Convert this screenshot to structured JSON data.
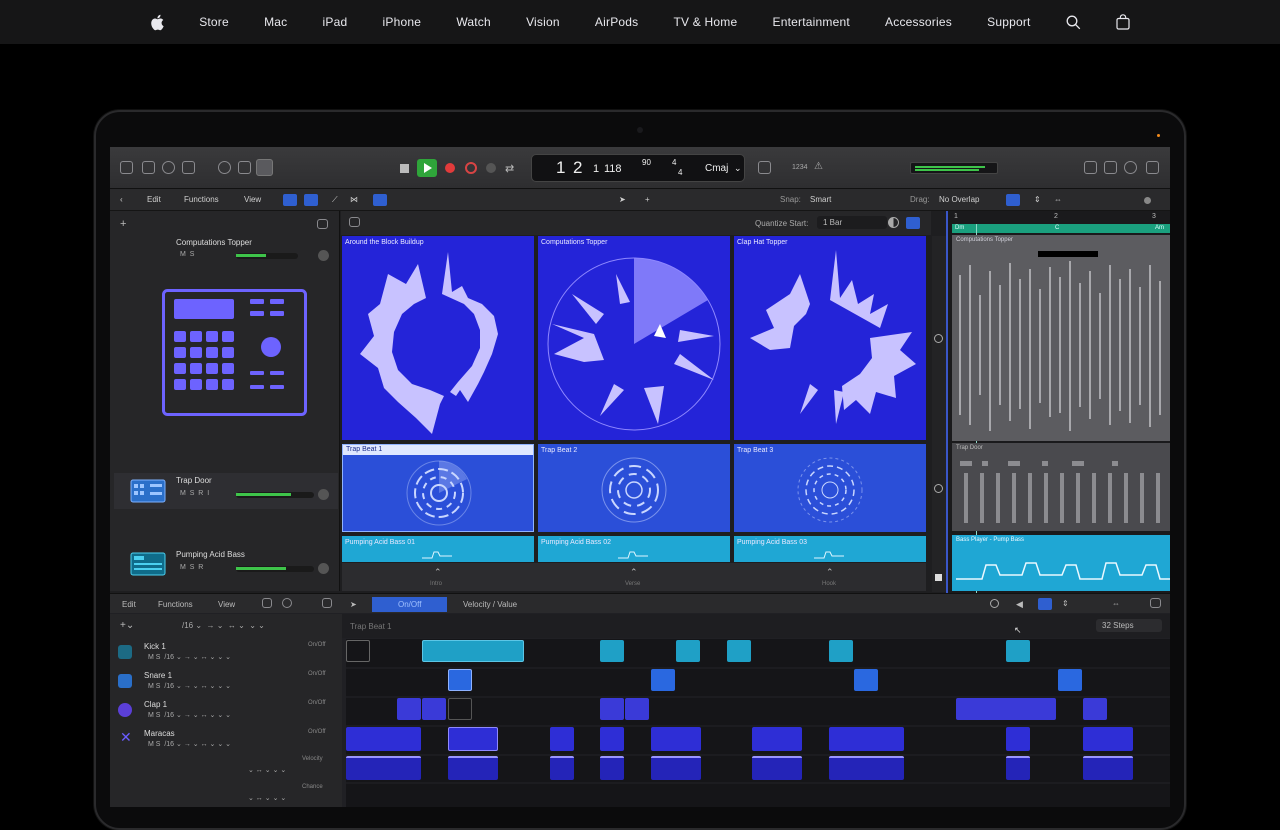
{
  "nav": {
    "items": [
      "Store",
      "Mac",
      "iPad",
      "iPhone",
      "Watch",
      "Vision",
      "AirPods",
      "TV & Home",
      "Entertainment",
      "Accessories",
      "Support"
    ]
  },
  "daw": {
    "lcd": {
      "bar": "1",
      "beat": "2",
      "div": "1",
      "tick": "118",
      "tempo": "90",
      "sig_top": "4",
      "sig_bot": "4",
      "key": "Cmaj",
      "count": "1234"
    },
    "menus": {
      "edit": "Edit",
      "functions": "Functions",
      "view": "View",
      "snap_label": "Snap:",
      "snap": "Smart",
      "drag_label": "Drag:",
      "drag": "No Overlap",
      "quantize_label": "Quantize Start:",
      "quantize": "1 Bar"
    },
    "tracks": [
      {
        "name": "Computations Topper"
      },
      {
        "name": "Trap Door"
      },
      {
        "name": "Pumping Acid Bass"
      }
    ],
    "cells": [
      {
        "name": "Around the Block Buildup"
      },
      {
        "name": "Computations Topper"
      },
      {
        "name": "Clap Hat Topper"
      },
      {
        "name": "Trap Beat 1"
      },
      {
        "name": "Trap Beat 2"
      },
      {
        "name": "Trap Beat 3"
      },
      {
        "name": "Pumping Acid Bass 01"
      },
      {
        "name": "Pumping Acid Bass 02"
      },
      {
        "name": "Pumping Acid Bass 03"
      }
    ],
    "scenes": [
      "Intro",
      "Verse",
      "Hook"
    ],
    "timeline": {
      "ruler": [
        "1",
        "2",
        "3"
      ],
      "marker_a": "Dm",
      "marker_b": "C",
      "marker_c": "Am",
      "region1": "Computations Topper",
      "region2": "Trap Door",
      "region3": "Bass Player - Pump Bass"
    },
    "seq": {
      "edit": "Edit",
      "functions": "Functions",
      "view": "View",
      "mode": "On/Off",
      "param": "Velocity / Value",
      "region": "Trap Beat 1",
      "steps": "32 Steps",
      "rows": [
        {
          "name": "Kick 1",
          "state": "On/Off"
        },
        {
          "name": "Snare 1",
          "state": "On/Off"
        },
        {
          "name": "Clap 1",
          "state": "On/Off"
        },
        {
          "name": "Maracas",
          "state": "On/Off"
        }
      ],
      "sub1": "Velocity",
      "sub2": "Chance"
    }
  }
}
